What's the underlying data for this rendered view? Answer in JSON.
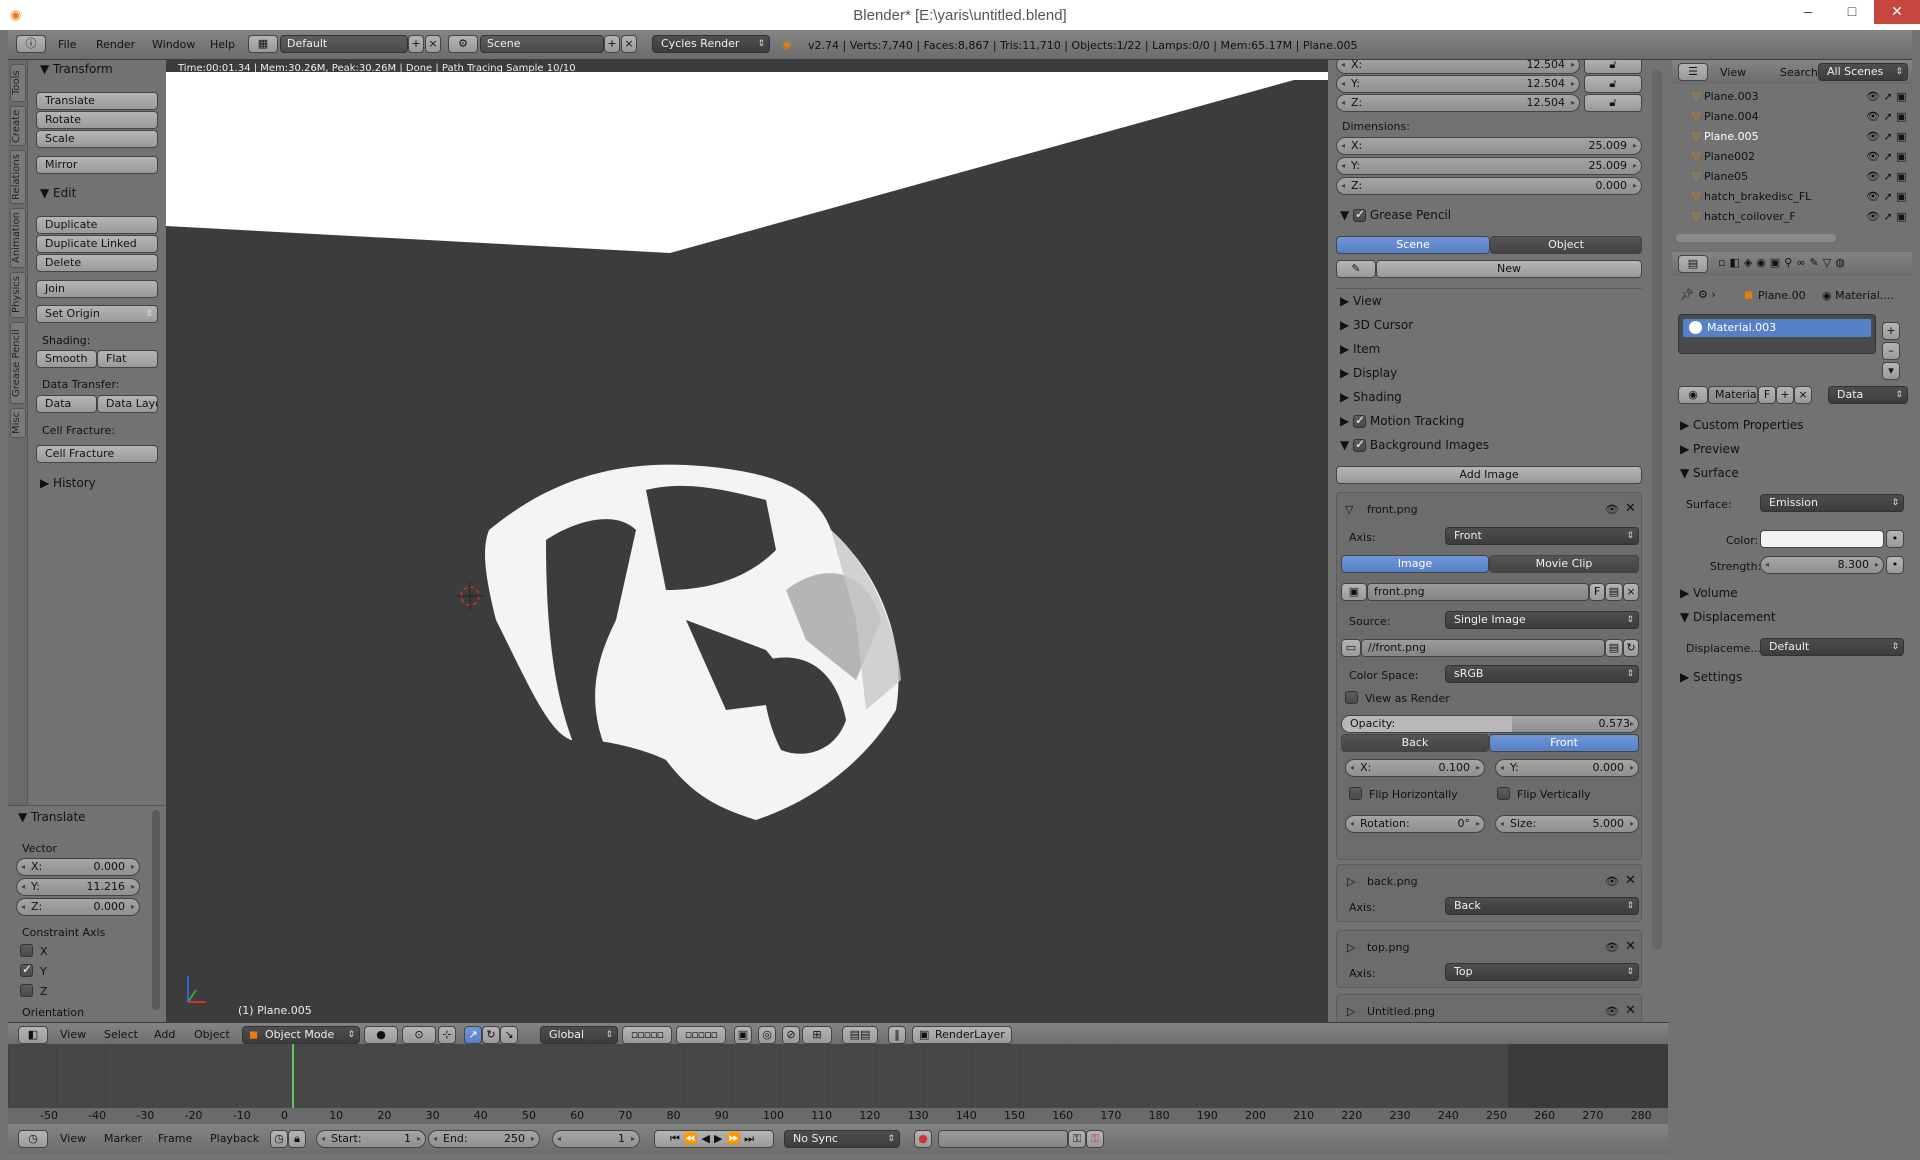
{
  "window": {
    "title": "Blender* [E:\\yaris\\untitled.blend]",
    "minimize": "–",
    "maximize": "□",
    "close": "✕"
  },
  "topbar": {
    "menus": [
      "File",
      "Render",
      "Window",
      "Help"
    ],
    "layout": "Default",
    "scene": "Scene",
    "engine": "Cycles Render",
    "stats": "v2.74 | Verts:7,740 | Faces:8,867 | Tris:11,710 | Objects:1/22 | Lamps:0/0 | Mem:65.17M | Plane.005"
  },
  "lefttabs": [
    "Tools",
    "Create",
    "Relations",
    "Animation",
    "Physics",
    "Grease Pencil",
    "Misc"
  ],
  "toolshelf": {
    "transform": {
      "title": "Transform",
      "translate": "Translate",
      "rotate": "Rotate",
      "scale": "Scale",
      "mirror": "Mirror"
    },
    "edit": {
      "title": "Edit",
      "duplicate": "Duplicate",
      "duplicate_linked": "Duplicate Linked",
      "delete": "Delete",
      "join": "Join",
      "set_origin": "Set Origin",
      "shading": "Shading:",
      "smooth": "Smooth",
      "flat": "Flat",
      "data_transfer": "Data Transfer:",
      "data": "Data",
      "data_layout": "Data Layo",
      "cell_fracture_label": "Cell Fracture:",
      "cell_fracture": "Cell Fracture"
    },
    "history": "History",
    "operator": {
      "title": "Translate",
      "vector": "Vector",
      "x_label": "X:",
      "x": "0.000",
      "y_label": "Y:",
      "y": "11.216",
      "z_label": "Z:",
      "z": "0.000",
      "constraint": "Constraint Axis",
      "cx": "X",
      "cy": "Y",
      "cz": "Z",
      "orientation": "Orientation"
    }
  },
  "viewport": {
    "status": "Time:00:01.34 | Mem:30.26M, Peak:30.26M | Done | Path Tracing Sample 10/10",
    "object_label": "(1) Plane.005"
  },
  "npanel": {
    "scale": {
      "x_label": "X:",
      "x": "12.504",
      "y_label": "Y:",
      "y": "12.504",
      "z_label": "Z:",
      "z": "12.504"
    },
    "dimensions": {
      "title": "Dimensions:",
      "x_label": "X:",
      "x": "25.009",
      "y_label": "Y:",
      "y": "25.009",
      "z_label": "Z:",
      "z": "0.000"
    },
    "grease_pencil": {
      "title": "Grease Pencil",
      "scene": "Scene",
      "object": "Object",
      "new": "New"
    },
    "sections": [
      "View",
      "3D Cursor",
      "Item",
      "Display",
      "Shading",
      "Motion Tracking",
      "Background Images"
    ],
    "add_image": "Add Image",
    "front": {
      "name": "front.png",
      "axis_label": "Axis:",
      "axis": "Front",
      "image": "Image",
      "movie_clip": "Movie Clip",
      "file": "front.png",
      "f": "F",
      "source_label": "Source:",
      "source": "Single Image",
      "path": "//front.png",
      "colorspace_label": "Color Space:",
      "colorspace": "sRGB",
      "view_as_render": "View as Render",
      "opacity_label": "Opacity:",
      "opacity": "0.573",
      "opacity_fraction": 0.573,
      "back": "Back",
      "front_btn": "Front",
      "x_label": "X:",
      "x": "0.100",
      "y_label": "Y:",
      "y": "0.000",
      "flip_h": "Flip Horizontally",
      "flip_v": "Flip Vertically",
      "rotation_label": "Rotation:",
      "rotation": "0°",
      "size_label": "Size:",
      "size": "5.000"
    },
    "back": {
      "name": "back.png",
      "axis_label": "Axis:",
      "axis": "Back"
    },
    "top": {
      "name": "top.png",
      "axis_label": "Axis:",
      "axis": "Top"
    },
    "untitled": {
      "name": "Untitled.png"
    }
  },
  "outliner": {
    "view": "View",
    "search": "Search",
    "scope": "All Scenes",
    "items": [
      "Plane.003",
      "Plane.004",
      "Plane.005",
      "Plane002",
      "Plane05",
      "hatch_brakedisc_FL",
      "hatch_coilover_F"
    ]
  },
  "properties": {
    "breadcrumb_object": "Plane.00",
    "breadcrumb_material": "Material....",
    "slot": "Material.003",
    "material_name": "Materia",
    "f": "F",
    "data": "Data",
    "custom_properties": "Custom Properties",
    "preview": "Preview",
    "surface": "Surface",
    "surface_label": "Surface:",
    "surface_value": "Emission",
    "color_label": "Color:",
    "strength_label": "Strength:",
    "strength": "8.300",
    "volume": "Volume",
    "displacement": "Displacement",
    "displacement_label": "Displaceme...",
    "displacement_value": "Default",
    "settings": "Settings"
  },
  "header3d": {
    "menus": [
      "View",
      "Select",
      "Add",
      "Object"
    ],
    "mode": "Object Mode",
    "orientation": "Global",
    "renderlayer": "RenderLayer"
  },
  "timeline": {
    "ticks": [
      "-50",
      "-40",
      "-30",
      "-20",
      "-10",
      "0",
      "10",
      "20",
      "30",
      "40",
      "50",
      "60",
      "70",
      "80",
      "90",
      "100",
      "110",
      "120",
      "130",
      "140",
      "150",
      "160",
      "170",
      "180",
      "190",
      "200",
      "210",
      "220",
      "230",
      "240",
      "250",
      "260",
      "270",
      "280"
    ],
    "menus": [
      "View",
      "Marker",
      "Frame",
      "Playback"
    ],
    "start_label": "Start:",
    "start": "1",
    "end_label": "End:",
    "end": "250",
    "current": "1",
    "sync": "No Sync"
  },
  "colors": {
    "accent": "#5680c8",
    "viewport_bg": "#3c3c3c",
    "panel_bg": "#727272"
  }
}
